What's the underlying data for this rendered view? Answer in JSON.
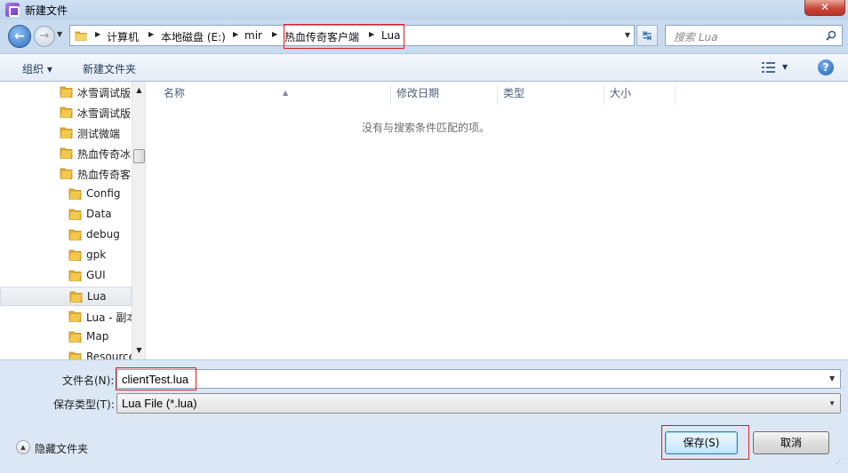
{
  "window": {
    "title": "新建文件",
    "close_glyph": "✕"
  },
  "nav": {
    "back_glyph": "←",
    "forward_glyph": "→",
    "breadcrumbs": [
      "计算机",
      "本地磁盘 (E:)",
      "mir",
      "热血传奇客户端",
      "Lua"
    ],
    "refresh_glyph": "↹"
  },
  "search": {
    "placeholder": "搜索 Lua"
  },
  "toolbar": {
    "organize_label": "组织 ▾",
    "new_folder_label": "新建文件夹",
    "help_glyph": "?"
  },
  "tree": {
    "items": [
      {
        "label": "冰雪调试版"
      },
      {
        "label": "冰雪调试版"
      },
      {
        "label": "测试微端"
      },
      {
        "label": "热血传奇冰"
      },
      {
        "label": "热血传奇客"
      },
      {
        "label": "Config"
      },
      {
        "label": "Data"
      },
      {
        "label": "debug"
      },
      {
        "label": "gpk"
      },
      {
        "label": "GUI"
      },
      {
        "label": "Lua",
        "selected": true
      },
      {
        "label": "Lua - 副本"
      },
      {
        "label": "Map"
      },
      {
        "label": "Resources"
      }
    ]
  },
  "file_list": {
    "columns": [
      "名称",
      "修改日期",
      "类型",
      "大小"
    ],
    "empty_message": "没有与搜索条件匹配的项。"
  },
  "form": {
    "filename_label": "文件名(N):",
    "filename_value": "clientTest.lua",
    "filetype_label": "保存类型(T):",
    "filetype_value": "Lua File (*.lua)"
  },
  "footer": {
    "hide_folders_label": "隐藏文件夹",
    "save_label": "保存(S)",
    "cancel_label": "取消"
  },
  "colors": {
    "highlight_box": "#e0191b",
    "folder_yellow": "#f2c94c"
  }
}
